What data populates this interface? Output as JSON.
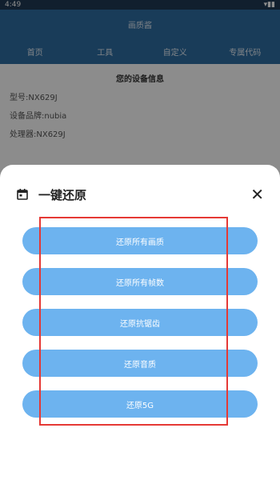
{
  "status_bar": {
    "left": "4:49",
    "right": "▾▮▮"
  },
  "app": {
    "title": "画质酱",
    "tabs": [
      "首页",
      "工具",
      "自定义",
      "专属代码"
    ],
    "device": {
      "heading": "您的设备信息",
      "model": "型号:NX629J",
      "brand": "设备品牌:nubia",
      "processor": "处理器:NX629J"
    }
  },
  "sheet": {
    "title": "一键还原",
    "close_glyph": "✕",
    "buttons": [
      {
        "label": "还原所有画质"
      },
      {
        "label": "还原所有帧数"
      },
      {
        "label": "还原抗锯齿"
      },
      {
        "label": "还原音质"
      },
      {
        "label": "还原5G"
      }
    ]
  },
  "colors": {
    "app_bar": "#2f6da3",
    "button": "#6db3ef",
    "highlight": "#e53935"
  }
}
